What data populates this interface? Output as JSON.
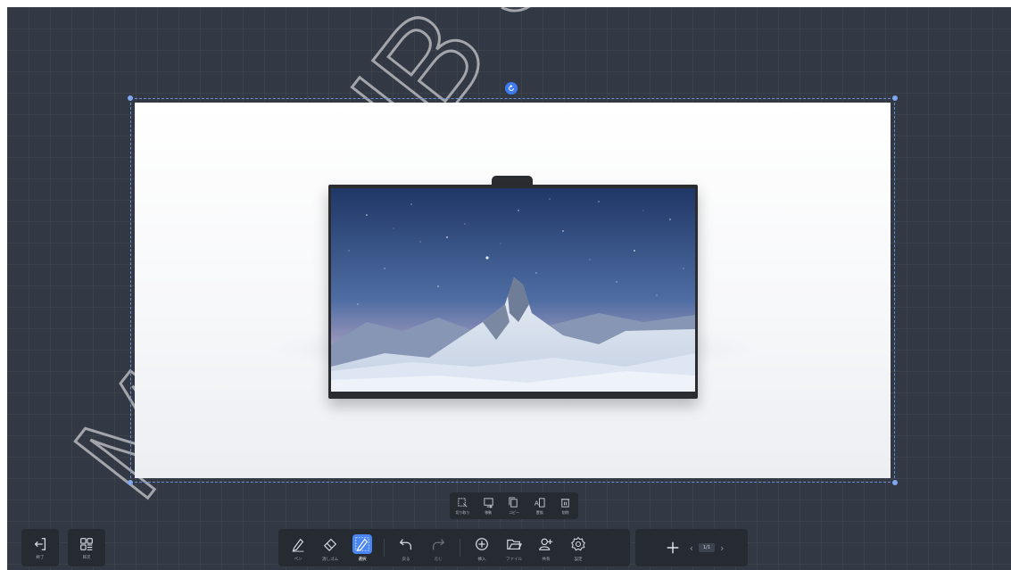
{
  "watermark": {
    "text": "MAXHUB SYSTEM"
  },
  "selection_toolbar": {
    "items": [
      {
        "label": "切り取り",
        "icon": "cut-icon"
      },
      {
        "label": "移動",
        "icon": "move-icon"
      },
      {
        "label": "コピー",
        "icon": "copy-icon"
      },
      {
        "label": "置換",
        "icon": "replace-text-icon"
      },
      {
        "label": "削除",
        "icon": "trash-icon"
      }
    ]
  },
  "left_toolbar": {
    "exit_label": "終了",
    "board_label": "目次"
  },
  "main_toolbar": {
    "pen_label": "ペン",
    "eraser_label": "消しゴム",
    "select_label": "選択",
    "undo_label": "戻る",
    "redo_label": "進む",
    "insert_label": "挿入",
    "file_label": "ファイル",
    "share_label": "共有",
    "settings_label": "設定",
    "active_tool": "select"
  },
  "page_nav": {
    "page_indicator": "1/1"
  },
  "colors": {
    "accent": "#4a86f2",
    "toolbar_bg": "#262a31",
    "canvas_bg": "#333944"
  }
}
